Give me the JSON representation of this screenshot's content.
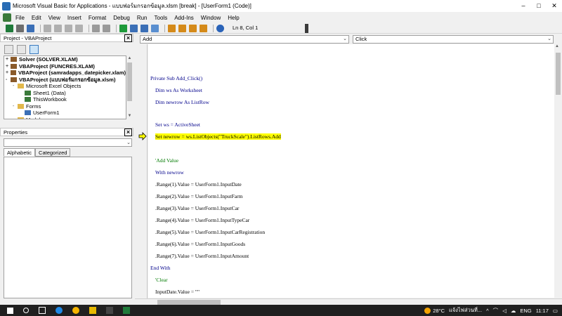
{
  "window": {
    "title": "Microsoft Visual Basic for Applications - แบบฟอร์มกรอกข้อมูล.xlsm [break] - [UserForm1 (Code)]"
  },
  "menu": [
    "File",
    "Edit",
    "View",
    "Insert",
    "Format",
    "Debug",
    "Run",
    "Tools",
    "Add-Ins",
    "Window",
    "Help"
  ],
  "toolbar": {
    "cursor_position": "Ln 8, Col 1"
  },
  "project": {
    "title": "Project - VBAProject",
    "tree": [
      {
        "label": "Solver (SOLVER.XLAM)",
        "bold": true,
        "exp": "+",
        "indent": 0,
        "icon": "vbaproject-icon"
      },
      {
        "label": "VBAProject (FUNCRES.XLAM)",
        "bold": true,
        "exp": "+",
        "indent": 0,
        "icon": "vbaproject-icon"
      },
      {
        "label": "VBAProject (samradapps_datepicker.xlam)",
        "bold": true,
        "exp": "+",
        "indent": 0,
        "icon": "vbaproject-icon"
      },
      {
        "label": "VBAProject (แบบฟอร์มกรอกข้อมูล.xlsm)",
        "bold": true,
        "exp": "-",
        "indent": 0,
        "icon": "vbaproject-icon"
      },
      {
        "label": "Microsoft Excel Objects",
        "bold": false,
        "exp": "-",
        "indent": 1,
        "icon": "folder-icon"
      },
      {
        "label": "Sheet1 (Data)",
        "bold": false,
        "exp": "",
        "indent": 2,
        "icon": "sheet-icon"
      },
      {
        "label": "ThisWorkbook",
        "bold": false,
        "exp": "",
        "indent": 2,
        "icon": "workbook-icon"
      },
      {
        "label": "Forms",
        "bold": false,
        "exp": "-",
        "indent": 1,
        "icon": "folder-icon"
      },
      {
        "label": "UserForm1",
        "bold": false,
        "exp": "",
        "indent": 2,
        "icon": "userform-icon"
      },
      {
        "label": "Modules",
        "bold": false,
        "exp": "-",
        "indent": 1,
        "icon": "folder-icon"
      }
    ]
  },
  "properties": {
    "title": "Properties",
    "tabs": [
      "Alphabetic",
      "Categorized"
    ]
  },
  "code_window": {
    "object_combo": "Add",
    "procedure_combo": "Click",
    "lines": [
      {
        "text": "Private Sub Add_Click()",
        "style": "kw"
      },
      {
        "text": "Dim ws As Worksheet",
        "style": "kw"
      },
      {
        "text": "Dim newrow As ListRow",
        "style": "kw"
      },
      {
        "text": "Set ws = ActiveSheet",
        "style": "kw"
      },
      {
        "text": "Set newrow = ws.ListObjects(\"TruckScale\").ListRows.Add",
        "style": "hl"
      },
      {
        "text": "'Add Value",
        "style": "cm"
      },
      {
        "text": "With newrow",
        "style": "kw"
      },
      {
        "text": ".Range(1).Value = UserForm1.InputDate",
        "style": ""
      },
      {
        "text": ".Range(2).Value = UserForm1.InputFarm",
        "style": ""
      },
      {
        "text": ".Range(3).Value = UserForm1.InputCar",
        "style": ""
      },
      {
        "text": ".Range(4).Value = UserForm1.InputTypeCar",
        "style": ""
      },
      {
        "text": ".Range(5).Value = UserForm1.InputCarRegistration",
        "style": ""
      },
      {
        "text": ".Range(6).Value = UserForm1.InputGoods",
        "style": ""
      },
      {
        "text": ".Range(7).Value = UserForm1.InputAmount",
        "style": ""
      },
      {
        "text": "End With",
        "style": "kw"
      },
      {
        "text": "'Clear",
        "style": "cm"
      },
      {
        "text": "InputDate.Value = \"\"",
        "style": ""
      }
    ]
  },
  "taskbar": {
    "weather": "28°C",
    "weather_desc": "แจ้งไฟส่วนที่...",
    "language": "ENG",
    "time": "11:17"
  },
  "colors": {
    "highlight": "#ffff00",
    "keyword": "#00008b",
    "comment": "#007a00"
  }
}
